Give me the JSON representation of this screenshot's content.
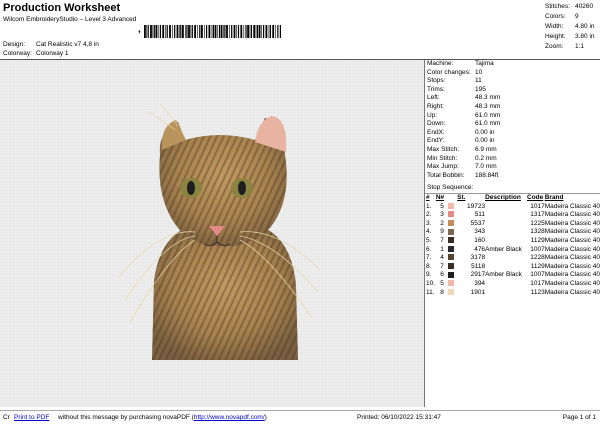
{
  "header": {
    "title": "Production Worksheet",
    "subtitle": "Wilcom EmbroideryStudio – Level 3 Advanced",
    "barcode_prefix": ",",
    "design_label": "Design:",
    "design_value": "Cat Realistic v7 4,8 in",
    "colorway_label": "Colorway:",
    "colorway_value": "Colorway 1"
  },
  "top_stats": [
    {
      "label": "Stitches:",
      "value": "40260"
    },
    {
      "label": "Colors:",
      "value": "9"
    },
    {
      "label": "Width:",
      "value": "4.80 in"
    },
    {
      "label": "Height:",
      "value": "3.80 in"
    },
    {
      "label": "Zoom:",
      "value": "1:1"
    }
  ],
  "machine_info": [
    {
      "label": "Machine:",
      "value": "Tajima"
    },
    {
      "label": "Color changes:",
      "value": "10"
    },
    {
      "label": "Stops:",
      "value": "11"
    },
    {
      "label": "Trims:",
      "value": "195"
    },
    {
      "label": "Left:",
      "value": "48.3 mm"
    },
    {
      "label": "Right:",
      "value": "48.3 mm"
    },
    {
      "label": "Up:",
      "value": "61.0 mm"
    },
    {
      "label": "Down:",
      "value": "61.0 mm"
    },
    {
      "label": "EndX:",
      "value": "0.00 in"
    },
    {
      "label": "EndY:",
      "value": "0.00 in"
    },
    {
      "label": "Max Stitch:",
      "value": "6.9 mm"
    },
    {
      "label": "Min Stitch:",
      "value": "0.2 mm"
    },
    {
      "label": "Max Jump:",
      "value": "7.0 mm"
    },
    {
      "label": "Total Bobbin:",
      "value": "188.84ft"
    }
  ],
  "stop_sequence": {
    "title": "Stop Sequence:",
    "headers": {
      "num": "#",
      "n": "N#",
      "st": "St.",
      "description": "Description",
      "code": "Code",
      "brand": "Brand"
    },
    "rows": [
      {
        "num": "1.",
        "n": "5",
        "color": "#f4b8a8",
        "st": "19723",
        "description": "",
        "code": "1017",
        "brand": "Madeira Classic 40"
      },
      {
        "num": "2.",
        "n": "3",
        "color": "#e48a86",
        "st": "511",
        "description": "",
        "code": "1317",
        "brand": "Madeira Classic 40"
      },
      {
        "num": "3.",
        "n": "2",
        "color": "#c08e58",
        "st": "5537",
        "description": "",
        "code": "1225",
        "brand": "Madeira Classic 40"
      },
      {
        "num": "4.",
        "n": "9",
        "color": "#7a6a50",
        "st": "343",
        "description": "",
        "code": "1328",
        "brand": "Madeira Classic 40"
      },
      {
        "num": "5.",
        "n": "7",
        "color": "#3a2e22",
        "st": "160",
        "description": "",
        "code": "1129",
        "brand": "Madeira Classic 40"
      },
      {
        "num": "6.",
        "n": "1",
        "color": "#2a2a2a",
        "st": "476",
        "description": "Amber Black",
        "code": "1007",
        "brand": "Madeira Classic 40"
      },
      {
        "num": "7.",
        "n": "4",
        "color": "#584632",
        "st": "3178",
        "description": "",
        "code": "1228",
        "brand": "Madeira Classic 40"
      },
      {
        "num": "8.",
        "n": "7",
        "color": "#3a2e22",
        "st": "5118",
        "description": "",
        "code": "1129",
        "brand": "Madeira Classic 40"
      },
      {
        "num": "9.",
        "n": "6",
        "color": "#1e1e1e",
        "st": "2917",
        "description": "Amber Black",
        "code": "1007",
        "brand": "Madeira Classic 40"
      },
      {
        "num": "10.",
        "n": "5",
        "color": "#f4b8a8",
        "st": "394",
        "description": "",
        "code": "1017",
        "brand": "Madeira Classic 40"
      },
      {
        "num": "11.",
        "n": "8",
        "color": "#f0d8b8",
        "st": "1901",
        "description": "",
        "code": "1123",
        "brand": "Madeira Classic 40"
      }
    ]
  },
  "footer": {
    "prefix": "Cr",
    "link_text": "Print to PDF",
    "message": " without this message by purchasing novaPDF (",
    "url": "http://www.novapdf.com/",
    "message_end": ")",
    "printed": "Printed: 06/10/2022 15:31:47",
    "page": "Page 1 of 1"
  },
  "colors": {
    "canvas_bg": "#ececec",
    "link": "#0000cc",
    "fur_main": "#b08a52",
    "fur_dark": "#4a3a26",
    "ear_pink": "#e9b3a1"
  }
}
